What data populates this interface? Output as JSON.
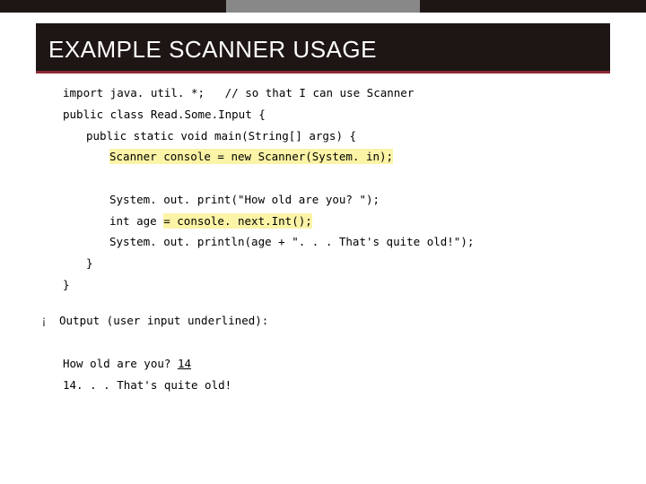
{
  "title": {
    "pre": "EXAMPLE ",
    "sc": "SCANNER",
    "post": " USAGE"
  },
  "code": {
    "l1a": "import java. util. *;   ",
    "l1b": "// so that I can use Scanner",
    "l2": "public class Read.Some.Input {",
    "l3": "public static void main(String[] args) {",
    "l4": "Scanner console = new Scanner(System. in);",
    "l5": "System. out. print(\"How old are you? \");",
    "l6a": "int age ",
    "l6b": "= console. next.Int();",
    "l7": "System. out. println(age + \". . . That's quite old!\");",
    "l8": "}",
    "l9": "}"
  },
  "bullet": "¡",
  "out_label": "Output (user input underlined):",
  "out_l1a": "How old are you? ",
  "out_l1b": "14",
  "out_l2": "14. . . That's quite old!"
}
